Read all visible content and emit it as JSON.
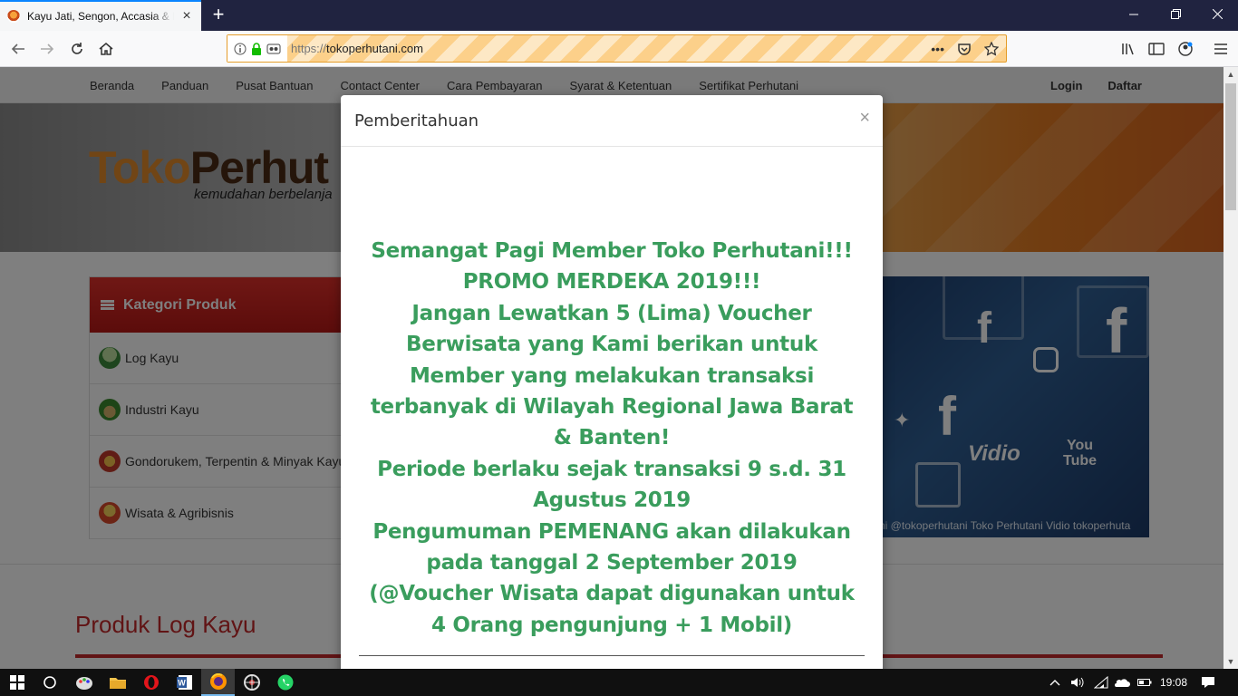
{
  "browser": {
    "tab_title": "Kayu Jati, Sengon, Accasia & Lainnya",
    "tab_close": "×",
    "new_tab": "+",
    "url_scheme": "https://",
    "url_host": "tokoperhutani.com",
    "page_actions": "•••"
  },
  "page": {
    "topnav": [
      "Beranda",
      "Panduan",
      "Pusat Bantuan",
      "Contact Center",
      "Cara Pembayaran",
      "Syarat & Ketentuan",
      "Sertifikat Perhutani"
    ],
    "login": "Login",
    "daftar": "Daftar",
    "brand_part1": "Toko",
    "brand_part2": "Perhut",
    "tagline": "kemudahan berbelanja",
    "kategori_title": "Kategori Produk",
    "kategori_items": [
      "Log Kayu",
      "Industri Kayu",
      "Gondorukem, Terpentin & Minyak Kayu",
      "Wisata & Agribisnis"
    ],
    "social_footer": "ni  @tokoperhutani   Toko Perhutani   Vidio tokoperhuta",
    "produk_title": "Produk Log Kayu"
  },
  "modal": {
    "title": "Pemberitahuan",
    "close": "×",
    "lines": [
      "Semangat Pagi Member Toko Perhutani!!!",
      "PROMO MERDEKA 2019!!!",
      "Jangan Lewatkan 5 (Lima) Voucher Berwisata yang Kami berikan untuk Member yang melakukan transaksi terbanyak di Wilayah Regional Jawa Barat & Banten!",
      "Periode berlaku sejak transaksi 9 s.d. 31 Agustus 2019",
      "Pengumuman PEMENANG akan dilakukan pada tanggal 2 September 2019",
      "(@Voucher Wisata dapat digunakan untuk 4 Orang pengunjung + 1 Mobil)"
    ]
  },
  "taskbar": {
    "clock": "19:08"
  },
  "colors": {
    "promo_green": "#3a9d5d",
    "brand_red": "#c2282a",
    "url_highlight": "#fcd08a"
  }
}
